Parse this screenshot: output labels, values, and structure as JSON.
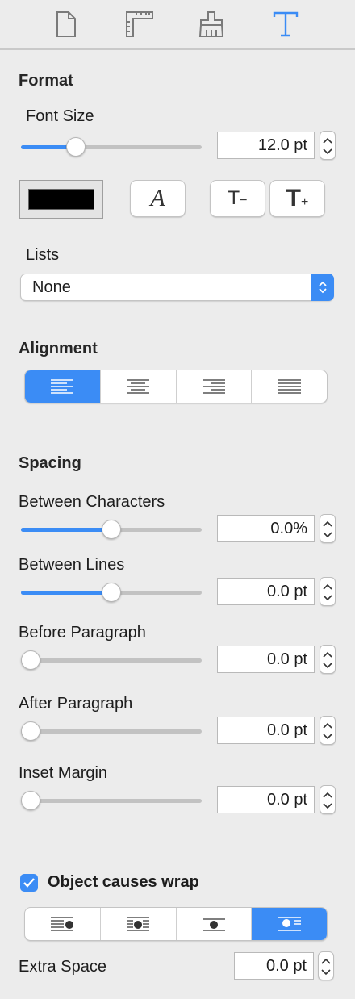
{
  "tabs": [
    {
      "name": "document-icon",
      "active": false
    },
    {
      "name": "ruler-icon",
      "active": false
    },
    {
      "name": "brush-icon",
      "active": false
    },
    {
      "name": "text-icon",
      "active": true
    }
  ],
  "format": {
    "title": "Format",
    "font_size_label": "Font Size",
    "font_size_value": "12.0 pt",
    "font_size_slider_fraction": 0.28,
    "color_swatch": "#000000",
    "font_button_glyph": "A",
    "decrease_glyph": "T",
    "decrease_sub": "−",
    "increase_glyph": "T",
    "increase_sub": "+",
    "lists_label": "Lists",
    "lists_value": "None"
  },
  "alignment": {
    "title": "Alignment",
    "options": [
      "align-left-icon",
      "align-center-icon",
      "align-right-icon",
      "align-justify-icon"
    ],
    "selected": 0
  },
  "spacing": {
    "title": "Spacing",
    "rows": [
      {
        "label": "Between Characters",
        "value": "0.0%",
        "slider_fraction": 0.5
      },
      {
        "label": "Between Lines",
        "value": "0.0 pt",
        "slider_fraction": 0.5
      },
      {
        "label": "Before Paragraph",
        "value": "0.0 pt",
        "slider_fraction": 0.0
      },
      {
        "label": "After Paragraph",
        "value": "0.0 pt",
        "slider_fraction": 0.0
      },
      {
        "label": "Inset Margin",
        "value": "0.0 pt",
        "slider_fraction": 0.0
      }
    ]
  },
  "wrap": {
    "checkbox_label": "Object causes wrap",
    "checked": true,
    "options": [
      "wrap-left-icon",
      "wrap-both-icon",
      "wrap-none-icon",
      "wrap-around-icon"
    ],
    "selected": 3,
    "extra_space_label": "Extra Space",
    "extra_space_value": "0.0 pt"
  },
  "colors": {
    "accent": "#3b8cf5",
    "background": "#ececec"
  }
}
